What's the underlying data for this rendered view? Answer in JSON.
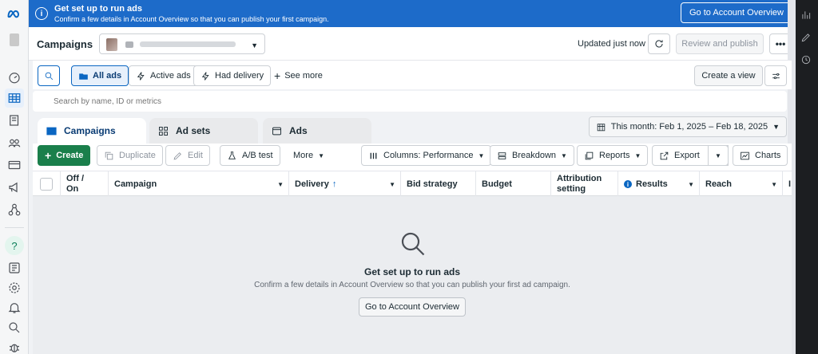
{
  "banner": {
    "title": "Get set up to run ads",
    "subtitle": "Confirm a few details in Account Overview so that you can publish your first campaign.",
    "button": "Go to Account Overview"
  },
  "header": {
    "title": "Campaigns",
    "updated": "Updated just now",
    "review_button": "Review and publish",
    "more": "•••"
  },
  "filters": {
    "all_ads": "All ads",
    "active_ads": "Active ads",
    "had_delivery": "Had delivery",
    "see_more": "See more",
    "create_view": "Create a view",
    "search_placeholder": "Search by name, ID or metrics"
  },
  "tabs": [
    {
      "label": "Campaigns"
    },
    {
      "label": "Ad sets"
    },
    {
      "label": "Ads"
    }
  ],
  "date_range": "This month: Feb 1, 2025 – Feb 18, 2025",
  "toolbar": {
    "create": "Create",
    "duplicate": "Duplicate",
    "edit": "Edit",
    "ab_test": "A/B test",
    "more": "More",
    "columns": "Columns: Performance",
    "breakdown": "Breakdown",
    "reports": "Reports",
    "export": "Export",
    "charts": "Charts"
  },
  "columns": {
    "off_on": "Off / On",
    "campaign": "Campaign",
    "delivery": "Delivery",
    "bid_strategy": "Bid strategy",
    "budget": "Budget",
    "attribution": "Attribution setting",
    "results": "Results",
    "reach": "Reach",
    "next": "I"
  },
  "empty_state": {
    "title": "Get set up to run ads",
    "subtitle": "Confirm a few details in Account Overview so that you can publish your first ad campaign.",
    "button": "Go to Account Overview"
  },
  "colors": {
    "brand_blue": "#1d6bc9",
    "create_green": "#1a7f4b",
    "selected_blue": "#0a66c2"
  }
}
